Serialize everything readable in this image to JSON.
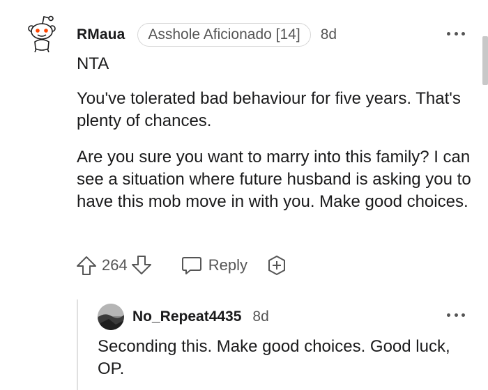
{
  "comment": {
    "author": "RMaua",
    "flair": "Asshole Aficionado [14]",
    "age": "8d",
    "paragraphs": [
      "NTA",
      "You've tolerated bad behaviour for five years. That's plenty of chances.",
      "Are you sure you want to marry into this family? I can see a situation where future husband is asking you to have this mob move in with you. Make good choices."
    ],
    "score": "264",
    "reply_label": "Reply"
  },
  "reply": {
    "author": "No_Repeat4435",
    "age": "8d",
    "text": "Seconding this. Make good choices. Good luck, OP."
  },
  "icons": {
    "avatar": "snoo-avatar-icon",
    "more": "more-options-icon",
    "upvote": "upvote-arrow-icon",
    "downvote": "downvote-arrow-icon",
    "reply": "speech-bubble-icon",
    "award": "award-plus-icon"
  },
  "colors": {
    "text": "#1a1a1b",
    "muted": "#555555",
    "snoo_eyes": "#ff4500"
  }
}
